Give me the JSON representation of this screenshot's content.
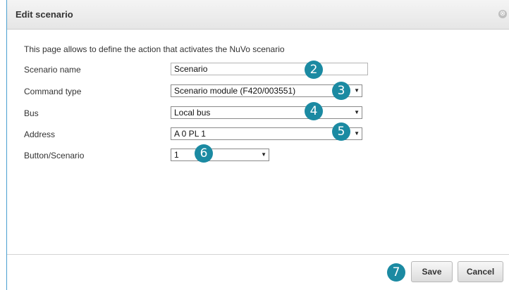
{
  "dialog": {
    "title": "Edit scenario",
    "close_glyph": "⊗",
    "intro": "This page allows to define the action that activates the NuVo scenario"
  },
  "form": {
    "scenario_name": {
      "label": "Scenario name",
      "value": "Scenario"
    },
    "command_type": {
      "label": "Command type",
      "value": "Scenario module (F420/003551)"
    },
    "bus": {
      "label": "Bus",
      "value": "Local bus"
    },
    "address": {
      "label": "Address",
      "value": "A 0 PL 1"
    },
    "button_scenario": {
      "label": "Button/Scenario",
      "value": "1"
    }
  },
  "dropdown_glyph": "▼",
  "badges": [
    "2",
    "3",
    "4",
    "5",
    "6",
    "7"
  ],
  "footer": {
    "save_label": "Save",
    "cancel_label": "Cancel"
  },
  "colors": {
    "badge": "#1b8aa2",
    "dialog_border": "#4a9fd0"
  }
}
